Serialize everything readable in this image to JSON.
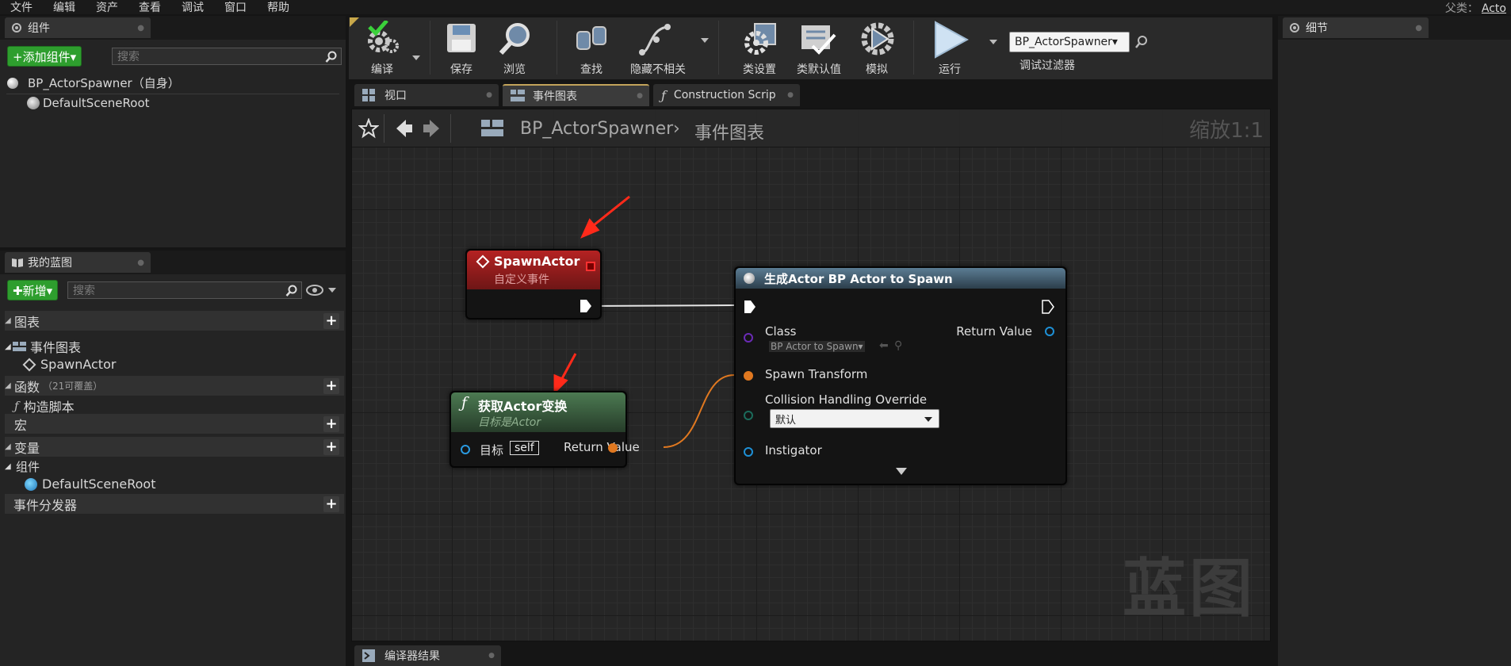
{
  "menu": [
    "文件",
    "编辑",
    "资产",
    "查看",
    "调试",
    "窗口",
    "帮助"
  ],
  "parent_class": {
    "label": "父类：",
    "value": "Acto"
  },
  "components_panel": {
    "tab_label": "组件",
    "add_button": "+添加组件▾",
    "search_placeholder": "搜索",
    "root_item": "BP_ActorSpawner（自身）",
    "child_item": "DefaultSceneRoot"
  },
  "my_blueprint": {
    "tab_label": "我的蓝图",
    "new_button": "✚新增▾",
    "search_placeholder": "搜索",
    "sections": {
      "graphs": "图表",
      "event_graph": "事件图表",
      "spawn_actor_item": "SpawnActor",
      "functions": "函数",
      "functions_note": "（21可覆盖）",
      "construction_script": "构造脚本",
      "macros": "宏",
      "variables": "变量",
      "components": "组件",
      "default_scene_root": "DefaultSceneRoot",
      "event_dispatchers": "事件分发器"
    }
  },
  "toolbar": {
    "compile": "编译",
    "save": "保存",
    "browse": "浏览",
    "find": "查找",
    "hide_unrelated": "隐藏不相关",
    "class_settings": "类设置",
    "class_defaults": "类默认值",
    "simulate": "模拟",
    "play": "运行",
    "debug_object": "BP_ActorSpawner▾",
    "debug_filter": "调试过滤器"
  },
  "doc_tabs": [
    "视口",
    "事件图表",
    "Construction Scrip"
  ],
  "graph": {
    "breadcrumb_root": "BP_ActorSpawner",
    "breadcrumb_sep": "›",
    "breadcrumb_current": "事件图表",
    "zoom": "缩放1:1",
    "watermark": "蓝图"
  },
  "nodes": {
    "spawn_event": {
      "title": "SpawnActor",
      "subtitle": "自定义事件"
    },
    "get_transform": {
      "title": "获取Actor变换",
      "subtitle": "目标是Actor",
      "target_label": "目标",
      "self_value": "self",
      "return_value": "Return Value"
    },
    "spawn_actor": {
      "title": "生成Actor BP Actor to Spawn",
      "class_label": "Class",
      "class_value": "BP Actor to Spawn▾",
      "return_value": "Return Value",
      "spawn_transform": "Spawn Transform",
      "collision_label": "Collision Handling Override",
      "collision_value": "默认",
      "instigator": "Instigator"
    }
  },
  "compiler_results_tab": "编译器结果",
  "details_panel": {
    "tab_label": "细节"
  },
  "colors": {
    "event_head": "#a81e1e",
    "function_head": "#3f6b45",
    "spawn_head": "#3d5668",
    "exec_wire": "#e6e6e6",
    "transform_wire": "#e07820",
    "class_pin": "#6a2bb5",
    "object_pin": "#1e90d6",
    "collision_pin": "#1b6b5b",
    "arrow": "#ff2a1a"
  }
}
